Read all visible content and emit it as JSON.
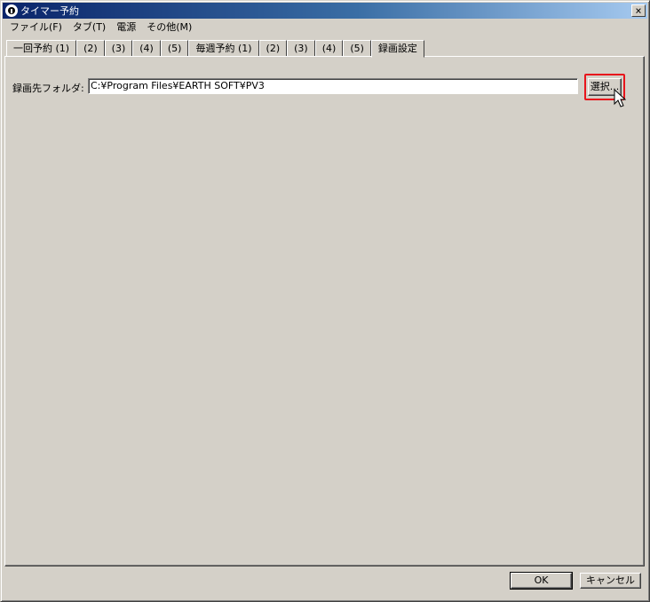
{
  "window": {
    "title": "タイマー予約",
    "close_label": "×"
  },
  "menu": [
    {
      "label": "ファイル(F)"
    },
    {
      "label": "タブ(T)"
    },
    {
      "label": "電源"
    },
    {
      "label": "その他(M)"
    }
  ],
  "tabs": [
    {
      "label": "一回予約 (1)"
    },
    {
      "label": "(2)"
    },
    {
      "label": "(3)"
    },
    {
      "label": "(4)"
    },
    {
      "label": "(5)"
    },
    {
      "label": "毎週予約 (1)"
    },
    {
      "label": "(2)"
    },
    {
      "label": "(3)"
    },
    {
      "label": "(4)"
    },
    {
      "label": "(5)"
    },
    {
      "label": "録画設定"
    }
  ],
  "settings": {
    "folder_label": "録画先フォルダ:",
    "folder_value": "C:¥Program Files¥EARTH SOFT¥PV3",
    "select_button": "選択..."
  },
  "footer": {
    "ok": "OK",
    "cancel": "キャンセル"
  },
  "colors": {
    "titlebar_start": "#0a246a",
    "titlebar_end": "#a6caf0",
    "face": "#d4d0c8",
    "highlight_box": "#e8141c"
  }
}
